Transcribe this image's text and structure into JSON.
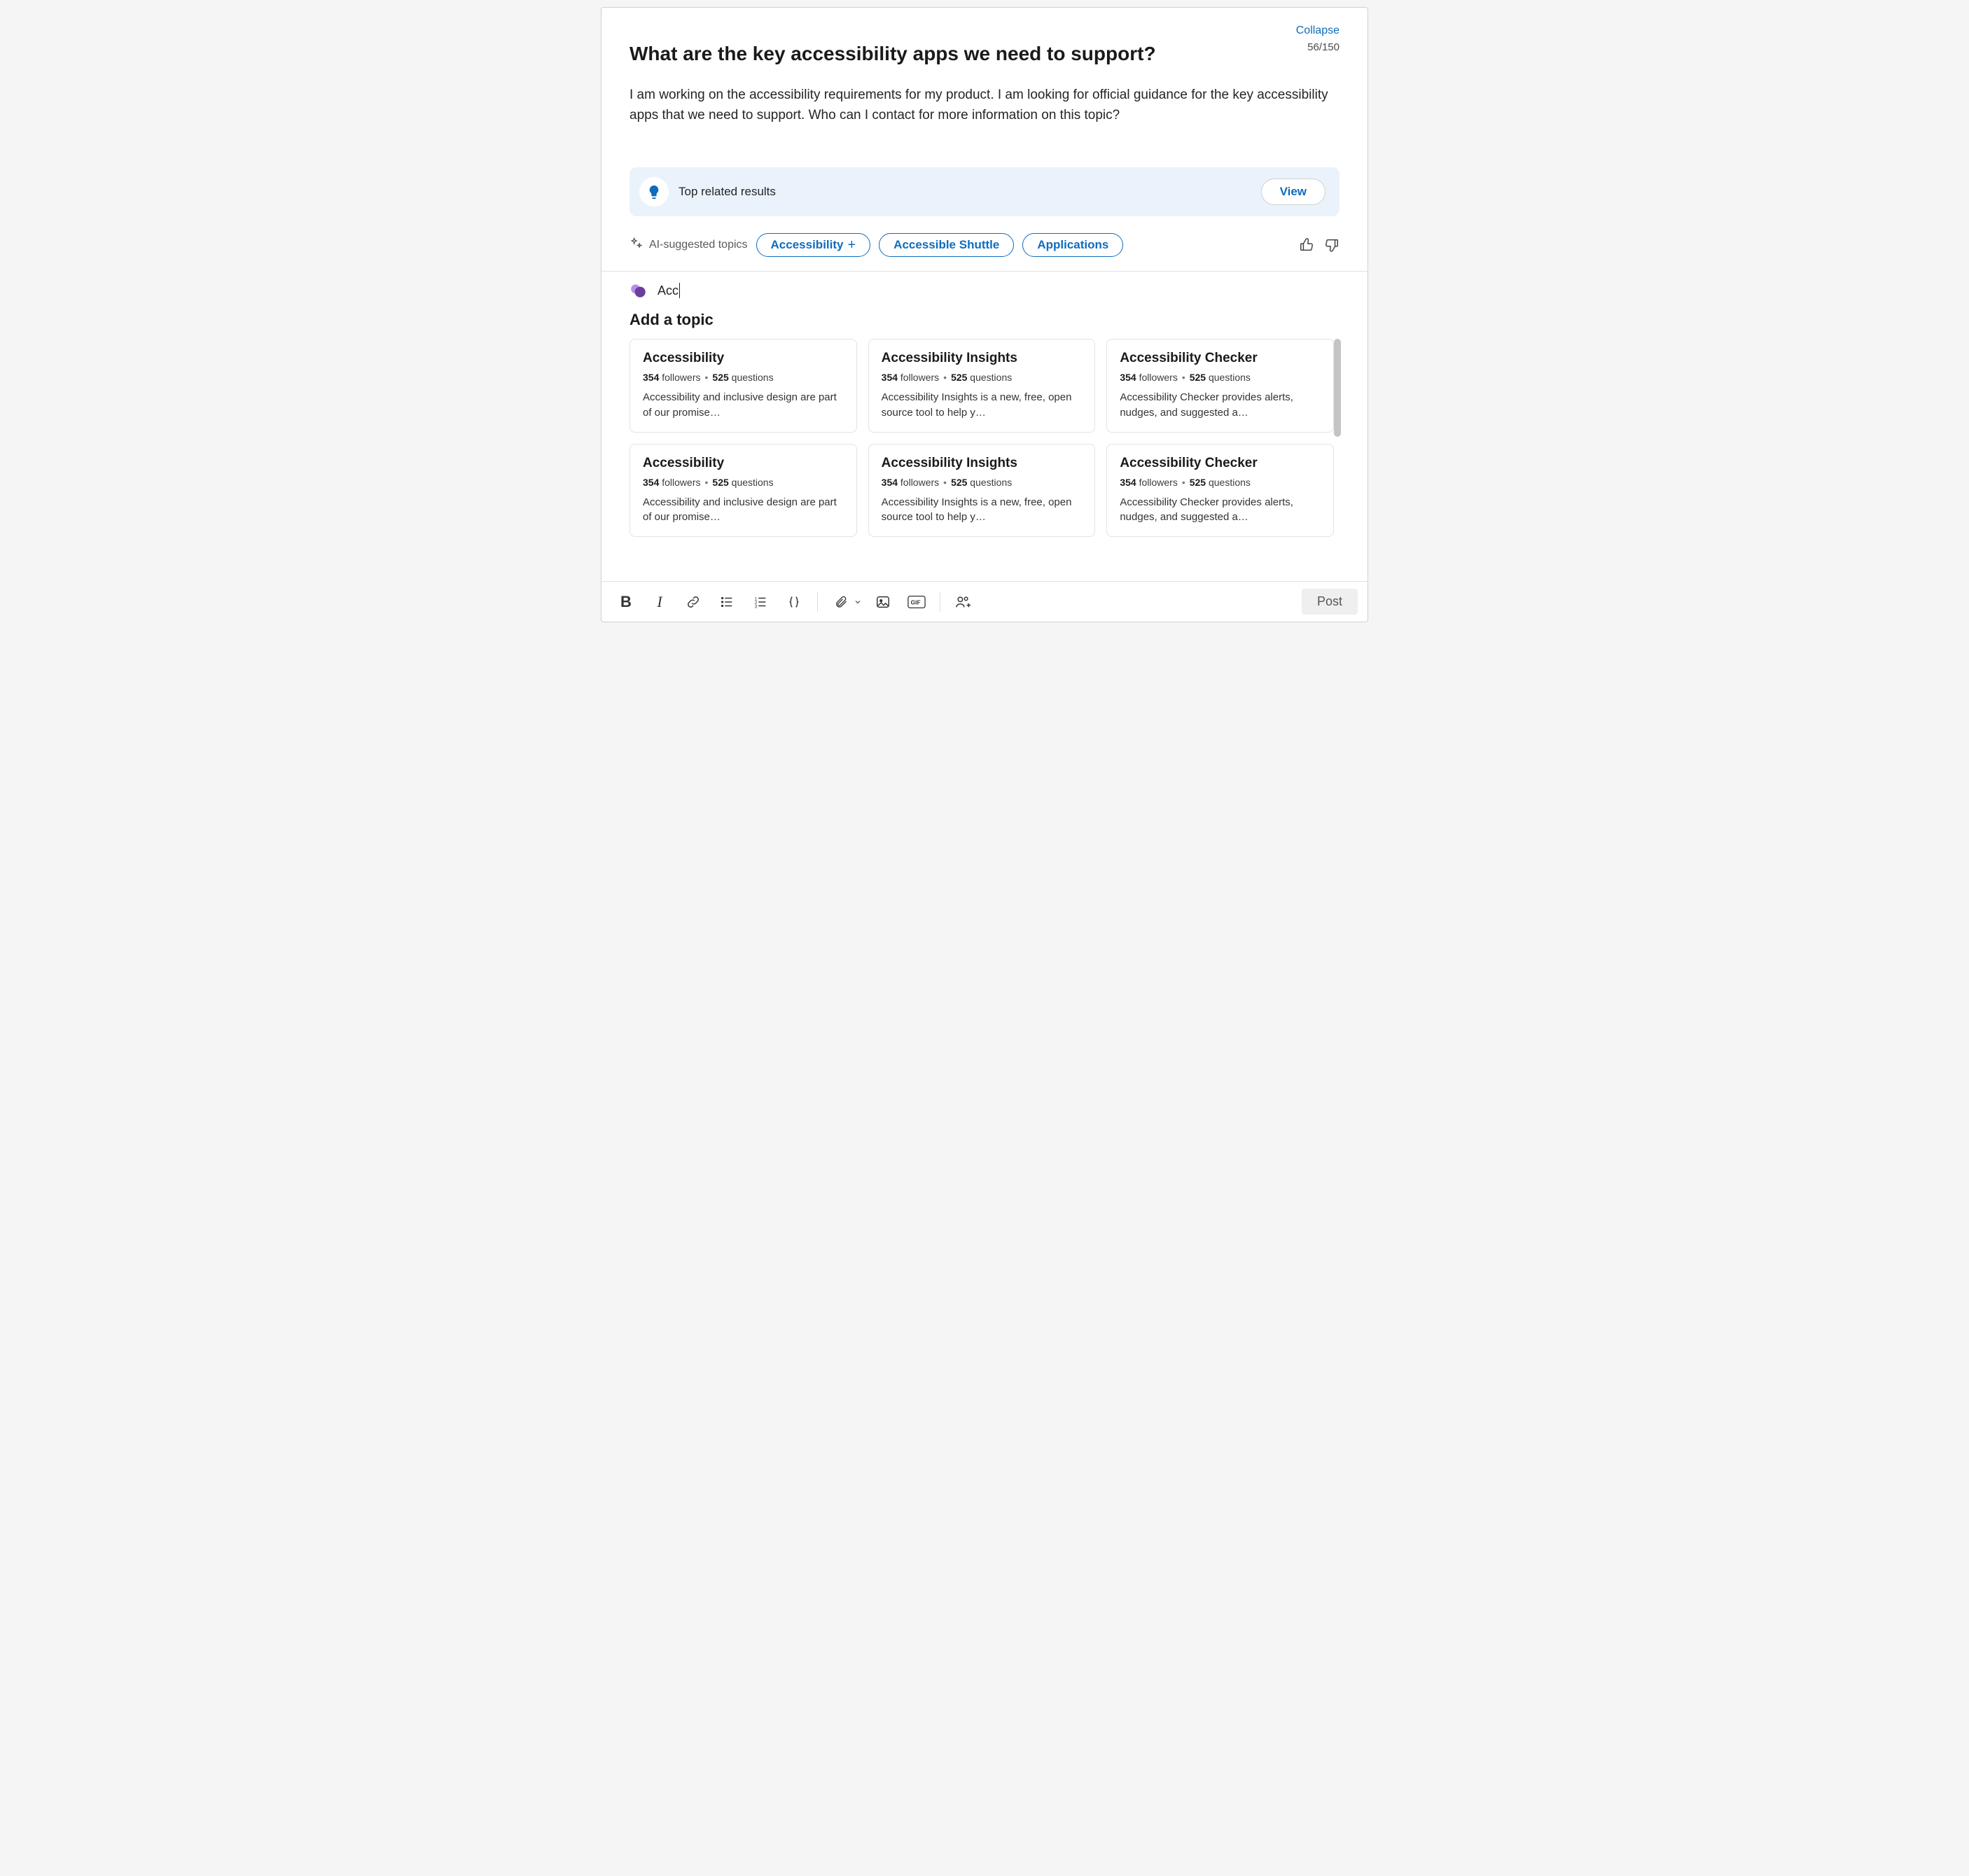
{
  "header": {
    "collapse": "Collapse",
    "char_count": "56/150",
    "title": "What are the key accessibility apps we need to support?"
  },
  "body": "I am working on the accessibility requirements for my product. I am looking for official guidance for the key accessibility apps that we need to support. Who can I contact for more information on this topic?",
  "related": {
    "label": "Top related results",
    "view": "View"
  },
  "ai": {
    "label": "AI-suggested topics",
    "pills": [
      "Accessibility",
      "Accessible Shuttle",
      "Applications"
    ]
  },
  "topic_input": "Acc",
  "add_topic_heading": "Add a topic",
  "cards": [
    {
      "title": "Accessibility",
      "followers": "354",
      "questions": "525",
      "desc": "Accessibility and inclusive design are part of our promise…"
    },
    {
      "title": "Accessibility Insights",
      "followers": "354",
      "questions": "525",
      "desc": "Accessibility Insights is a new, free, open source tool to help y…"
    },
    {
      "title": "Accessibility Checker",
      "followers": "354",
      "questions": "525",
      "desc": "Accessibility Checker provides alerts, nudges, and suggested a…"
    },
    {
      "title": "Accessibility",
      "followers": "354",
      "questions": "525",
      "desc": "Accessibility and inclusive design are part of our promise…"
    },
    {
      "title": "Accessibility Insights",
      "followers": "354",
      "questions": "525",
      "desc": "Accessibility Insights is a new, free, open source tool to help y…"
    },
    {
      "title": "Accessibility Checker",
      "followers": "354",
      "questions": "525",
      "desc": "Accessibility Checker provides alerts, nudges, and suggested a…"
    }
  ],
  "meta_labels": {
    "followers": "followers",
    "questions": "questions"
  },
  "toolbar": {
    "post": "Post"
  }
}
